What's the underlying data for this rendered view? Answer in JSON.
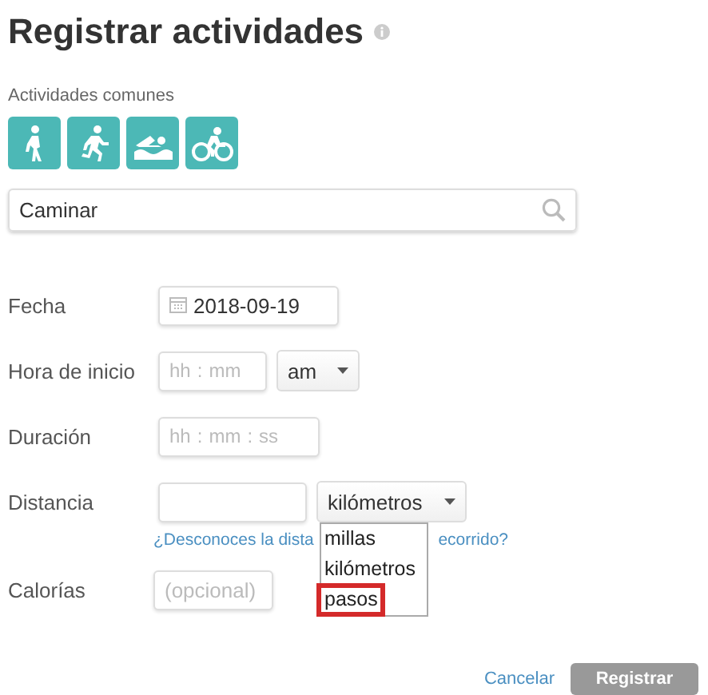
{
  "title": "Registrar actividades",
  "common_activities": {
    "label": "Actividades comunes",
    "items": [
      {
        "kind": "walk"
      },
      {
        "kind": "run"
      },
      {
        "kind": "swim"
      },
      {
        "kind": "bike"
      }
    ]
  },
  "search": {
    "value": "Caminar"
  },
  "fields": [
    {
      "kind": "date",
      "label": "Fecha",
      "value": "2018-09-19"
    },
    {
      "kind": "time",
      "label": "Hora de inicio",
      "parts": [
        "hh",
        ":",
        "mm"
      ],
      "ampm": "am"
    },
    {
      "kind": "duration",
      "label": "Duración",
      "parts": [
        "hh",
        ":",
        "mm",
        ":",
        "ss"
      ]
    },
    {
      "kind": "distance",
      "label": "Distancia",
      "unit": "kilómetros",
      "link_parts": [
        "¿Desconoces la dista",
        "ecorrido?"
      ],
      "expanded": true,
      "options": [
        {
          "label": "millas",
          "highlighted": false
        },
        {
          "label": "kilómetros",
          "highlighted": false
        },
        {
          "label": "pasos",
          "highlighted": true
        }
      ]
    },
    {
      "kind": "calories",
      "label": "Calorías",
      "placeholder": "(opcional)"
    }
  ],
  "buttons": {
    "cancel": "Cancelar",
    "submit": "Registrar"
  }
}
